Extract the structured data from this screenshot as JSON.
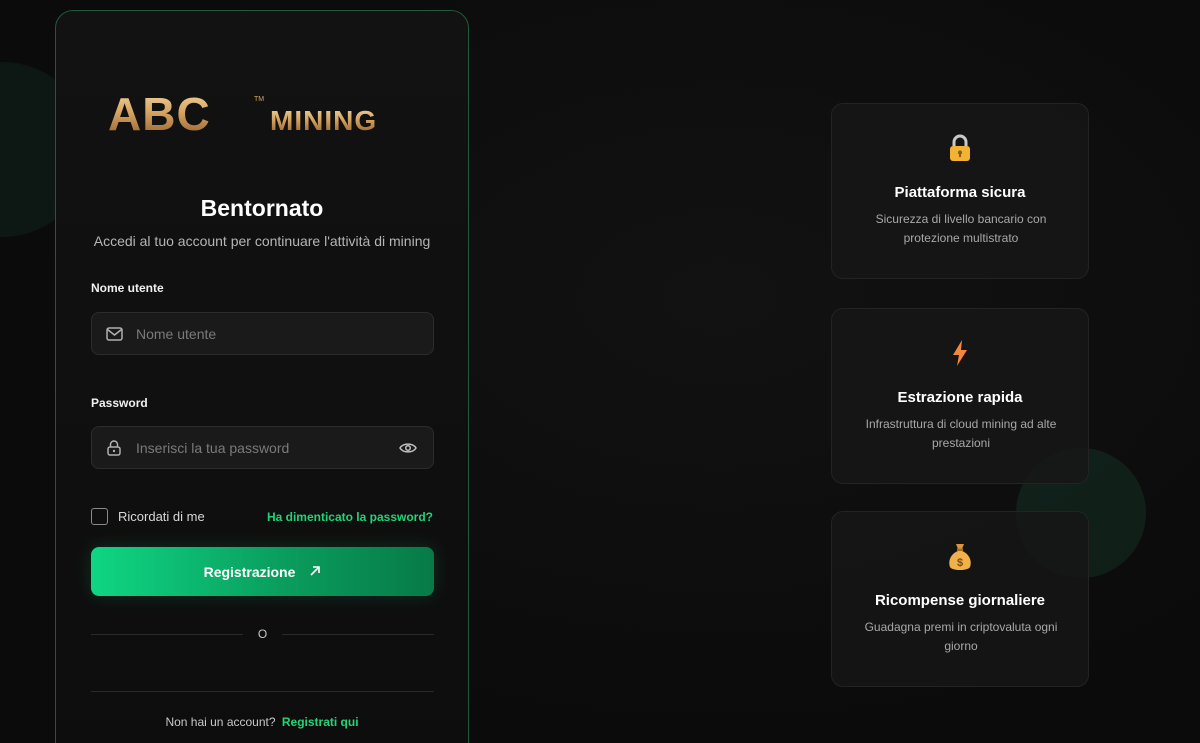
{
  "brand": {
    "logo_text": "ABC",
    "logo_subtext": "MINING",
    "trademark": "TM"
  },
  "login": {
    "title": "Bentornato",
    "subtitle": "Accedi al tuo account per continuare l'attività di mining",
    "username_label": "Nome utente",
    "username_placeholder": "Nome utente",
    "password_label": "Password",
    "password_placeholder": "Inserisci la tua password",
    "remember_label": "Ricordati di me",
    "forgot_link": "Ha dimenticato la password?",
    "submit_label": "Registrazione",
    "divider_text": "O",
    "no_account_text": "Non hai un account?",
    "signup_link": "Registrati qui"
  },
  "features": [
    {
      "icon": "lock-icon",
      "title": "Piattaforma sicura",
      "description": "Sicurezza di livello bancario con protezione multistrato"
    },
    {
      "icon": "lightning-icon",
      "title": "Estrazione rapida",
      "description": "Infrastruttura di cloud mining ad alte prestazioni"
    },
    {
      "icon": "money-bag-icon",
      "title": "Ricompense giornaliere",
      "description": "Guadagna premi in criptovaluta ogni giorno"
    }
  ],
  "colors": {
    "accent": "#22d377",
    "button_start": "#0fd683",
    "button_end": "#077a48",
    "card_border": "#1f5a3b",
    "background": "#0c0c0c",
    "logo_gold": "#d6a96a"
  }
}
